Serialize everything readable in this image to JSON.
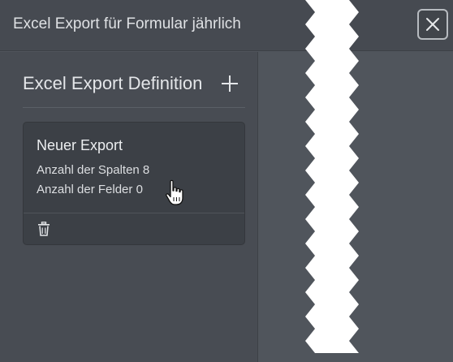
{
  "header": {
    "title": "Excel Export für Formular jährlich"
  },
  "panel": {
    "title": "Excel Export Definition"
  },
  "exports": [
    {
      "name": "Neuer Export",
      "columns_label": "Anzahl der Spalten 8",
      "fields_label": "Anzahl der Felder 0"
    }
  ],
  "colors": {
    "header_bg": "#464a51",
    "panel_bg": "#484c53",
    "card_bg": "#3c4046",
    "text": "#e4e6e9"
  },
  "icons": [
    "close-icon",
    "plus-icon",
    "trash-icon",
    "hand-cursor-icon"
  ]
}
